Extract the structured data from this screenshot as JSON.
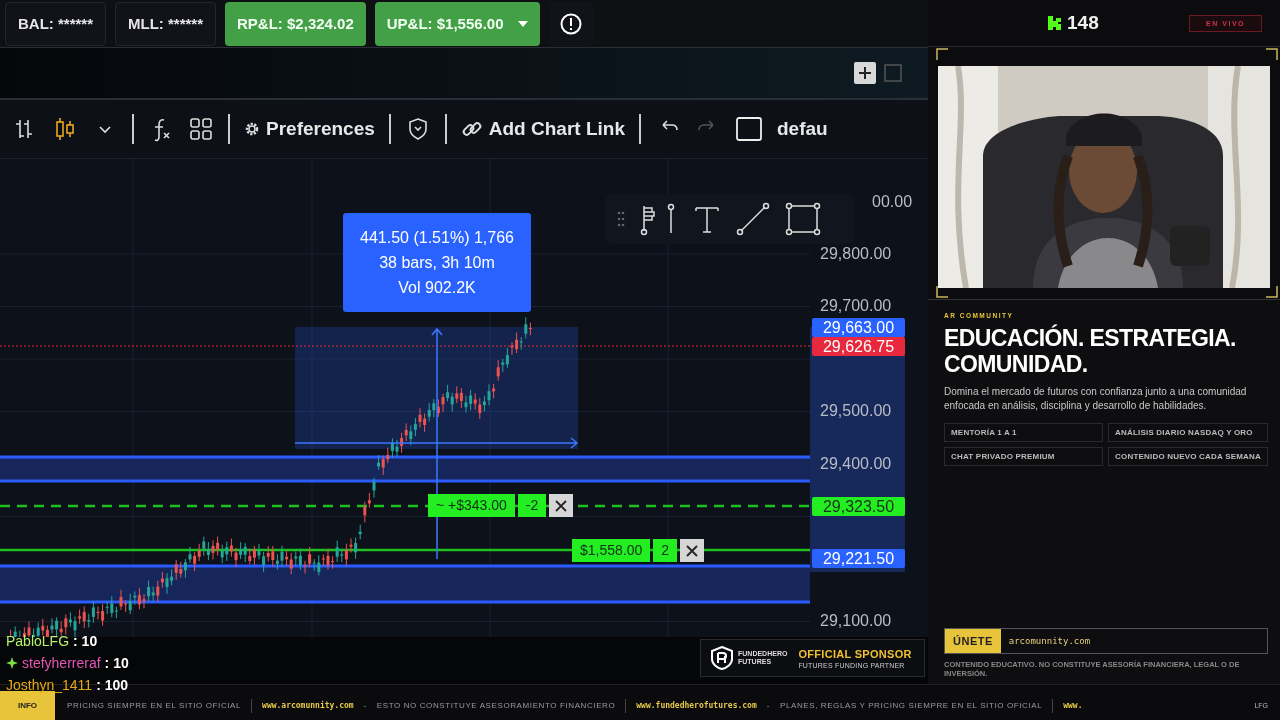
{
  "account_bar": {
    "items": [
      {
        "kind": "stat",
        "label": "BAL: ******"
      },
      {
        "kind": "stat",
        "label": "MLL: ******"
      },
      {
        "kind": "pnl",
        "label": "RP&L: $2,324.02",
        "dropdown": false
      },
      {
        "kind": "pnl",
        "label": "UP&L: $1,556.00",
        "dropdown": true
      }
    ]
  },
  "chart_toolbar": {
    "preferences": "Preferences",
    "chart_link": "Add Chart Link",
    "layout": "defau",
    "undo": {
      "disabled": false
    },
    "redo": {
      "disabled": true
    }
  },
  "chart": {
    "price_labels": [
      "00.00",
      "29,800.00",
      "29,700.00",
      "29,500.00",
      "29,400.00",
      "29,100.00"
    ],
    "markers": [
      {
        "label": "29,663.00",
        "color": "#2962ff"
      },
      {
        "label": "29,626.75",
        "color": "#e8283c"
      },
      {
        "label": "29,323.50",
        "color": "#22ee22"
      },
      {
        "label": "29,221.50",
        "color": "#2962ff"
      }
    ],
    "measure_tooltip": [
      "441.50 (1.51%) 1,766",
      "38 bars, 3h 10m",
      "Vol 902.2K"
    ],
    "orders": [
      {
        "pnl": "~ +$343.00",
        "qty": "-2"
      },
      {
        "pnl": "$1,558.00",
        "qty": "2"
      }
    ]
  },
  "chat": [
    {
      "user": "PabloLFG",
      "text": ": 10",
      "color": "#b4f06a",
      "badge": false
    },
    {
      "user": "stefyherreraf",
      "text": ": 10",
      "color": "#e456b4",
      "badge": true
    },
    {
      "user": "Josthyn_1411",
      "text": ": 100",
      "color": "#e8a810",
      "badge": false
    }
  ],
  "sponsor": {
    "brand": [
      "FUNDEDHERO",
      "FUTURES"
    ],
    "title": "OFFICIAL SPONSOR",
    "subtitle": "FUTURES FUNDING PARTNER"
  },
  "live": {
    "viewers": "148",
    "status": "EN VIVO"
  },
  "promo": {
    "kicker": "AR COMMUNITY",
    "headline": "EDUCACIÓN. ESTRATEGIA. COMUNIDAD.",
    "text": "Domina el mercado de futuros con confianza junto a una comunidad enfocada en análisis, disciplina y desarrollo de habilidades.",
    "features": [
      "MENTORÍA 1 A 1",
      "ANÁLISIS DIARIO NASDAQ Y ORO",
      "CHAT PRIVADO PREMIUM",
      "CONTENIDO NUEVO CADA SEMANA"
    ],
    "join": {
      "button": "ÚNETE",
      "url": "arcomunnity.com"
    },
    "disclaimer": "CONTENIDO EDUCATIVO. NO CONSTITUYE ASESORÍA FINANCIERA, LEGAL O DE INVERSIÓN."
  },
  "ticker": {
    "tag": "INFO",
    "items": [
      {
        "kind": "text",
        "text": "PRICING SIEMPRE EN EL SITIO OFICIAL"
      },
      {
        "kind": "divider"
      },
      {
        "kind": "link",
        "text": "www.arcomunnity.com"
      },
      {
        "kind": "text",
        "text": "-"
      },
      {
        "kind": "text",
        "text": "ESTO NO CONSTITUYE ASESORAMIENTO FINANCIERO"
      },
      {
        "kind": "divider"
      },
      {
        "kind": "link",
        "text": "www.fundedherofutures.com"
      },
      {
        "kind": "text",
        "text": "-"
      },
      {
        "kind": "text",
        "text": "PLANES, REGLAS Y PRICING SIEMPRE EN EL SITIO OFICIAL"
      },
      {
        "kind": "divider"
      },
      {
        "kind": "link",
        "text": "www."
      }
    ],
    "end_tag": "LFG"
  }
}
